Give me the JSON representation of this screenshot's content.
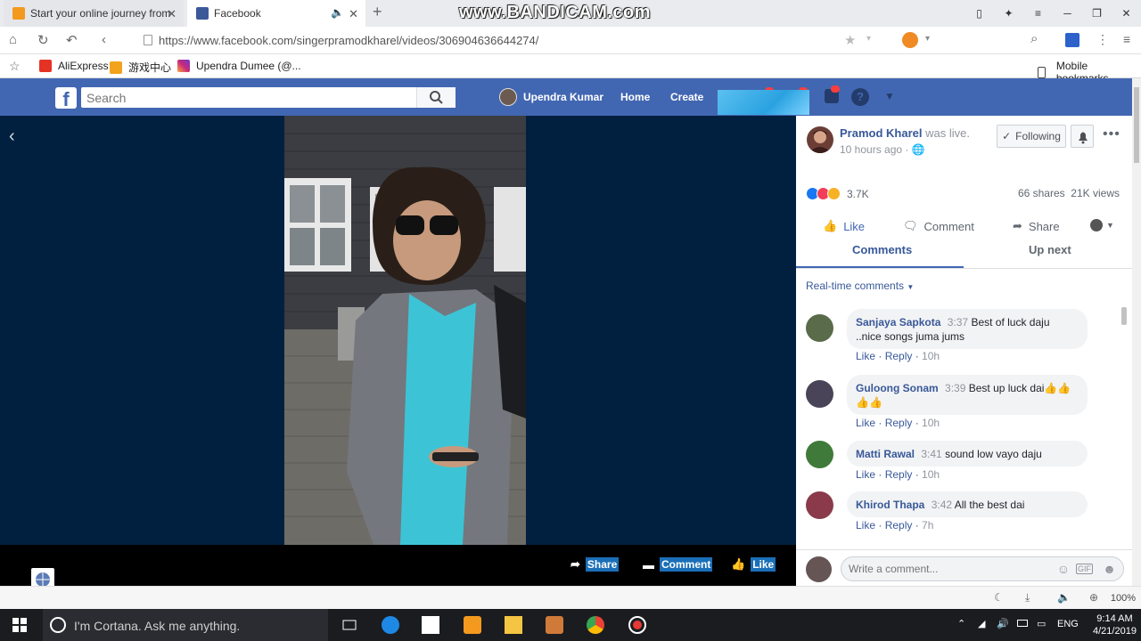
{
  "browser": {
    "tabs": [
      {
        "title": "Start your online journey from",
        "active": false
      },
      {
        "title": "Facebook",
        "active": true
      }
    ],
    "watermark": "www.BANDICAM.com",
    "url": "https://www.facebook.com/singerpramodkharel/videos/306904636644274/",
    "bookmarks": [
      {
        "label": "AliExpress",
        "icon": "aliexpress-icon"
      },
      {
        "label": "游戏中心",
        "icon": "game-center-icon"
      },
      {
        "label": "Upendra Dumee (@...",
        "icon": "instagram-icon"
      }
    ],
    "mobile_bookmarks": "Mobile bookmarks",
    "zoom": "100%"
  },
  "fb_header": {
    "search_placeholder": "Search",
    "user_name": "Upendra Kumar",
    "home": "Home",
    "create": "Create"
  },
  "video": {
    "actions": {
      "share": "Share",
      "comment": "Comment",
      "like": "Like"
    }
  },
  "post": {
    "poster": "Pramod Kharel",
    "status": "was live.",
    "time": "10 hours ago",
    "following": "Following",
    "reaction_count": "3.7K",
    "stats": "66 shares  21K views",
    "actions": {
      "like": "Like",
      "comment": "Comment",
      "share": "Share"
    },
    "tabs": {
      "comments": "Comments",
      "up_next": "Up next"
    },
    "realtime_label": "Real-time comments",
    "comments": [
      {
        "name": "Sanjaya Sapkota",
        "ts": "3:37",
        "text": "Best of luck daju ..nice songs juma jums",
        "like": "Like",
        "reply": "Reply",
        "age": "10h",
        "avatar_color": "#5a6b4a"
      },
      {
        "name": "Guloong Sonam",
        "ts": "3:39",
        "text": "Best up luck dai👍👍👍👍",
        "like": "Like",
        "reply": "Reply",
        "age": "10h",
        "avatar_color": "#4a4458"
      },
      {
        "name": "Matti Rawal",
        "ts": "3:41",
        "text": "sound low vayo daju",
        "like": "Like",
        "reply": "Reply",
        "age": "10h",
        "avatar_color": "#3f7a3a"
      },
      {
        "name": "Khirod Thapa",
        "ts": "3:42",
        "text": "All the best dai",
        "like": "Like",
        "reply": "Reply",
        "age": "7h",
        "avatar_color": "#8a3a4a"
      }
    ],
    "write_placeholder": "Write a comment..."
  },
  "taskbar": {
    "cortana": "I'm Cortana. Ask me anything.",
    "lang": "ENG",
    "time": "9:14 AM",
    "date": "4/21/2019"
  },
  "colors": {
    "fb_blue": "#4267b2",
    "link": "#385898",
    "video_bg": "#01203f"
  }
}
